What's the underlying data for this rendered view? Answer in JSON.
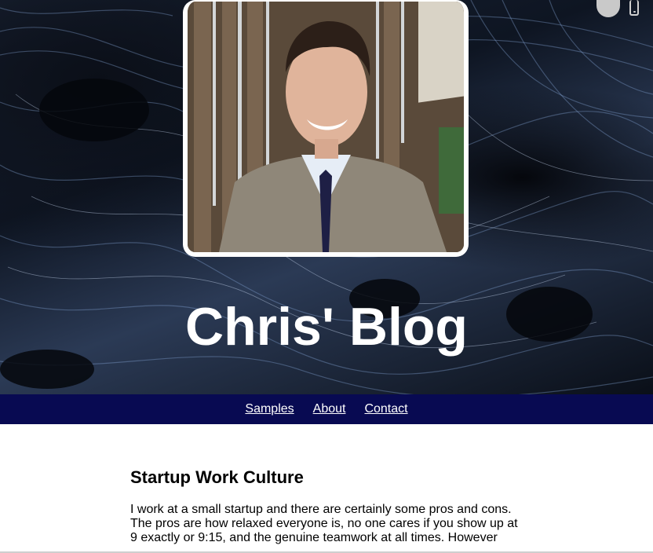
{
  "hero": {
    "title": "Chris' Blog"
  },
  "top_icons": [
    "circle-icon",
    "phone-icon"
  ],
  "nav": {
    "items": [
      {
        "label": "Samples"
      },
      {
        "label": "About"
      },
      {
        "label": "Contact"
      }
    ]
  },
  "post": {
    "title": "Startup Work Culture",
    "body": "I work at a small startup and there are certainly some pros and cons. The pros are how relaxed everyone is, no one cares if you show up at 9 exactly or 9:15, and the genuine teamwork at all times. However"
  },
  "colors": {
    "nav_bg": "#080a52",
    "hero_dark": "#0e1522",
    "accent_swirl": "#8fb3e6"
  }
}
